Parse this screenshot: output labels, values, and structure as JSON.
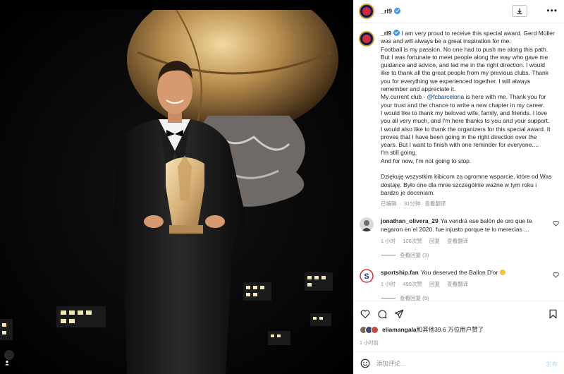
{
  "colors": {
    "accent": "#0095f6",
    "muted": "#8e8e8e",
    "link": "#00376b",
    "verified": "#3897f0"
  },
  "icons": {
    "download": "download-icon",
    "more": "more-horizontal-icon",
    "heart": "heart-icon",
    "comment": "comment-icon",
    "share": "send-icon",
    "save": "bookmark-icon",
    "emoji": "smiley-icon",
    "tag": "user-tag-icon"
  },
  "post": {
    "username": "_rl9",
    "more_label": "•••",
    "caption": {
      "username": "_rl9",
      "lines": [
        "I am very proud to receive this special award. Gerd Müller",
        "was and will always be a great inspiration for me.",
        "Football is my passion. No one had to push me along this path.",
        "But I was fortunate to meet people along the way who gave me",
        "guidance and advice, and led me in the right direction. I would",
        "like to thank all the great people from my previous clubs. Thank",
        "you for everything we experienced together. I will always",
        "remember and appreciate it.",
        "My current club - ",
        " is here with me. Thank you for",
        "your trust and the chance to write a new chapter in my career.",
        "I would like to thank my beloved wife, family, and friends. I love",
        "you all very much, and I'm here thanks to you and your support.",
        "I would also like to thank the organizers for this special award. It",
        "proves that I have been going in the right direction over the",
        "years. But I want to finish with one reminder for everyone....",
        "I'm still going.",
        "And for now, I'm not going to stop.",
        "",
        "Dziękuję wszystkim kibicom za ogromne wsparcie, które od Was",
        "dostaję. Było one dla mnie szczególnie ważne w tym roku i",
        "bardzo je doceniam."
      ],
      "mention": "@fcbarcelona",
      "edited": "已编辑",
      "age": "31分钟",
      "translate": "查看翻译"
    },
    "comments": [
      {
        "username": "jonathan_olivera_29",
        "text_line1": "Ya vendrá ese balón de oro que te",
        "text_line2": "negaron en el 2020. fue injusto porque te lo merecias ...",
        "age": "1 小时",
        "likes": "106次赞",
        "reply": "回复",
        "translate": "查看翻译",
        "replies": "查看回复 (3)"
      },
      {
        "username": "sportship.fan",
        "text": "You deserved the Ballon D'or",
        "age": "1 小时",
        "likes": "490次赞",
        "reply": "回复",
        "translate": "查看翻译",
        "replies": "查看回复 (9)"
      }
    ],
    "likes": {
      "user": "eliamangala",
      "rest": "和其他39.6 万位用户赞了"
    },
    "time": "1 小时前",
    "add_comment": {
      "placeholder": "添加评论...",
      "post_label": "发布"
    }
  }
}
